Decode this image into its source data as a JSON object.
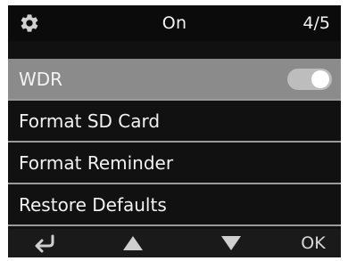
{
  "header": {
    "settings_icon": "gear-icon",
    "title": "On",
    "page_indicator": "4/5"
  },
  "menu": {
    "items": [
      {
        "label": "WDR",
        "selected": true,
        "toggle": "on"
      },
      {
        "label": "Format SD Card"
      },
      {
        "label": "Format Reminder"
      },
      {
        "label": "Restore Defaults"
      }
    ]
  },
  "footer": {
    "back_icon": "return-arrow-icon",
    "up_icon": "up-triangle-icon",
    "down_icon": "down-triangle-icon",
    "ok_label": "OK"
  },
  "colors": {
    "background": "#111111",
    "selected_row": "#8b8b8b",
    "divider": "#9a9a9a",
    "text": "#f2f2f2"
  }
}
